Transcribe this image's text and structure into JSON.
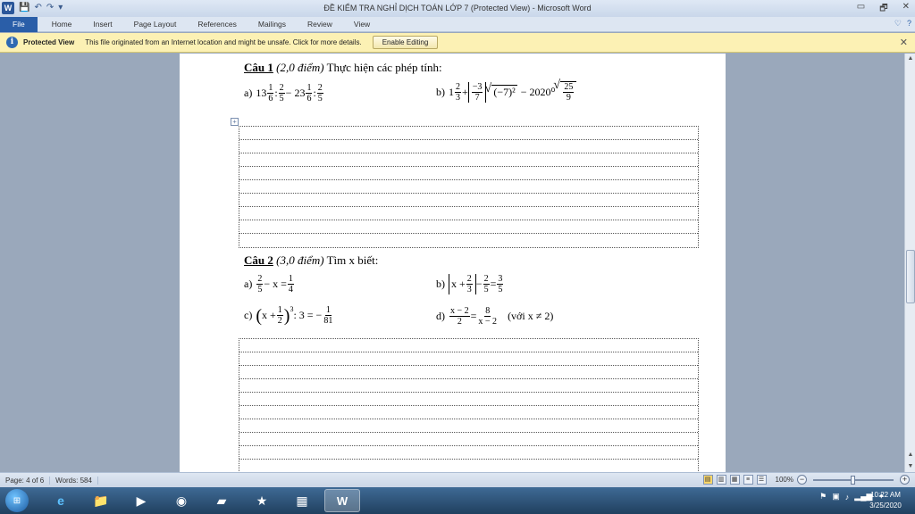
{
  "window": {
    "title": "ĐỀ KIỂM TRA NGHỈ DỊCH TOÁN  LỚP 7 (Protected View)  -  Microsoft Word",
    "logo": "W",
    "qat": [
      "save-icon",
      "undo-icon",
      "redo-icon",
      "customize-icon"
    ],
    "controls": {
      "minimize": "▭",
      "restore": "🗗",
      "close": "✕"
    }
  },
  "ribbon": {
    "tabs": [
      "File",
      "Home",
      "Insert",
      "Page Layout",
      "References",
      "Mailings",
      "Review",
      "View"
    ],
    "right": {
      "collapse": "♡",
      "help": "?"
    }
  },
  "protected_view": {
    "icon": "i",
    "title": "Protected View",
    "message": "This file originated from an Internet location and might be unsafe. Click for more details.",
    "button": "Enable Editing",
    "close": "✕"
  },
  "document": {
    "q1": {
      "label": "Câu 1",
      "points": "(2,0 điểm)",
      "text": "Thực hiện các phép tính:",
      "a": {
        "label": "a)",
        "w1": "13",
        "f1n": "1",
        "f1d": "6",
        "op1": ":",
        "f2n": "2",
        "f2d": "5",
        "op2": "− 23",
        "f3n": "1",
        "f3d": "6",
        "op3": ":",
        "f4n": "2",
        "f4d": "5"
      },
      "b": {
        "label": "b)",
        "w1": "1",
        "f1n": "2",
        "f1d": "3",
        "op1": "+",
        "absn": "−3",
        "absd": "7",
        "rad": "(−7)²",
        "op2": "− 2020⁰",
        "sqn": "25",
        "sqd": "9"
      }
    },
    "q2": {
      "label": "Câu 2",
      "points": "(3,0 điểm)",
      "text": "Tìm x biết:",
      "a": {
        "label": "a)",
        "f1n": "2",
        "f1d": "5",
        "mid": "− x =",
        "f2n": "1",
        "f2d": "4"
      },
      "b": {
        "label": "b)",
        "x": "x +",
        "f1n": "2",
        "f1d": "3",
        "op": "−",
        "f2n": "2",
        "f2d": "5",
        "eq": "=",
        "f3n": "3",
        "f3d": "5"
      },
      "c": {
        "label": "c)",
        "x": "x +",
        "f1n": "1",
        "f1d": "2",
        "pow": "3",
        "mid": ": 3 = −",
        "f2n": "1",
        "f2d": "81"
      },
      "d": {
        "label": "d)",
        "f1n": "x − 2",
        "f1d": "2",
        "eq": "=",
        "f2n": "8",
        "f2d": "x − 2",
        "cond": "(với x ≠ 2)"
      }
    },
    "table_handle": "+"
  },
  "status": {
    "page": "Page: 4 of 6",
    "words": "Words: 584",
    "zoom": "100%",
    "zoom_minus": "−",
    "zoom_plus": "+"
  },
  "taskbar": {
    "start": "⊞",
    "clock_time": "10:22 AM",
    "clock_date": "3/25/2020",
    "tray": [
      "flag-icon",
      "network-icon",
      "volume-icon",
      "signal-icon",
      "star-icon"
    ]
  }
}
